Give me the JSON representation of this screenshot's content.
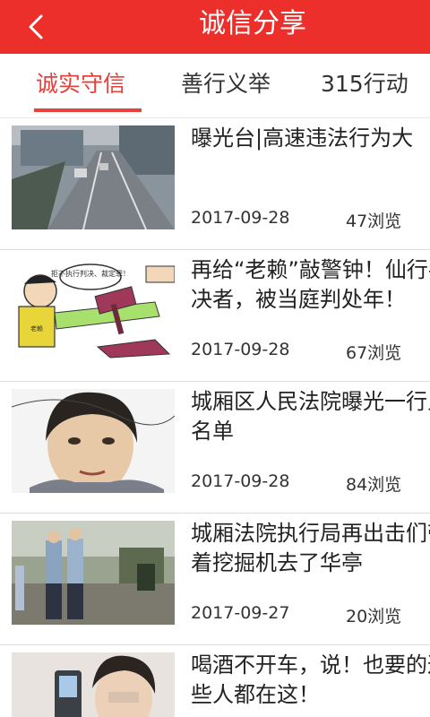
{
  "header": {
    "title": "诚信分享"
  },
  "tabs": [
    {
      "label": "诚实守信",
      "active": true
    },
    {
      "label": "善行义举",
      "active": false
    },
    {
      "label": "315行动",
      "active": false
    }
  ],
  "articles": [
    {
      "title": "曝光台|高速违法行为大",
      "date": "2017-09-28",
      "views": "47浏览"
    },
    {
      "title": "再给“老赖”敲警钟！仙行判决者，被当庭判处年！",
      "date": "2017-09-28",
      "views": "67浏览"
    },
    {
      "title": "城厢区人民法院曝光一行人名单",
      "date": "2017-09-28",
      "views": "84浏览"
    },
    {
      "title": "城厢法院执行局再出击们带着挖掘机去了华亭",
      "date": "2017-09-27",
      "views": "20浏览"
    },
    {
      "title": "喝酒不开车，说！也要的这些人都在这！",
      "date": "",
      "views": ""
    }
  ],
  "thumb_captions": {
    "cartoon_speech": "拒不执行判决、裁定罪！",
    "cartoon_shirt": "老赖"
  },
  "colors": {
    "brand_red": "#ec2f2b",
    "tab_active": "#e8403a"
  }
}
